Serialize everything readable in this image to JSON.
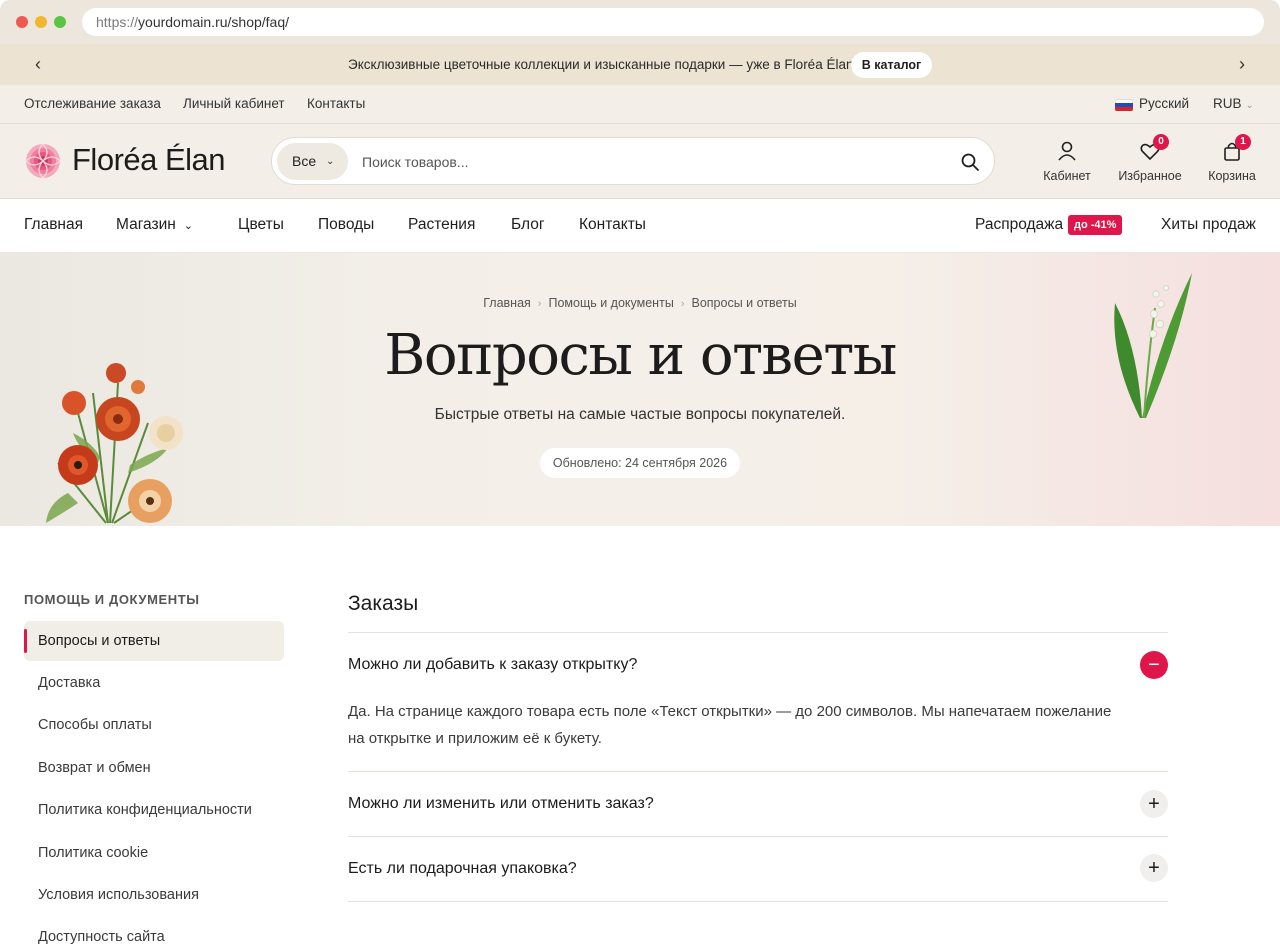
{
  "browser": {
    "url_scheme": "https://",
    "url_rest": "yourdomain.ru/shop/faq/"
  },
  "promo": {
    "text": "Эксклюзивные цветочные коллекции и изысканные подарки — уже в Floréa Élan.",
    "button": "В каталог",
    "prev_icon": "‹",
    "next_icon": "›"
  },
  "utility": {
    "links": [
      "Отслеживание заказа",
      "Личный кабинет",
      "Контакты"
    ],
    "language": "Русский",
    "currency": "RUB"
  },
  "header": {
    "brand": "Floréa Élan",
    "search_category": "Все",
    "search_placeholder": "Поиск товаров...",
    "account_label": "Кабинет",
    "wishlist_label": "Избранное",
    "wishlist_count": "0",
    "cart_label": "Корзина",
    "cart_count": "1"
  },
  "nav": {
    "items": [
      "Главная",
      "Магазин",
      "Цветы",
      "Поводы",
      "Растения",
      "Блог",
      "Контакты"
    ],
    "sale_label": "Распродажа",
    "sale_badge": "до -41%",
    "bestsellers": "Хиты продаж"
  },
  "hero": {
    "breadcrumb": [
      "Главная",
      "Помощь и документы",
      "Вопросы и ответы"
    ],
    "title": "Вопросы и ответы",
    "subtitle": "Быстрые ответы на самые частые вопросы покупателей.",
    "updated": "Обновлено: 24 сентября 2026"
  },
  "sidebar": {
    "title": "ПОМОЩЬ И ДОКУМЕНТЫ",
    "items": [
      "Вопросы и ответы",
      "Доставка",
      "Способы оплаты",
      "Возврат и обмен",
      "Политика конфиденциальности",
      "Политика cookie",
      "Условия использования",
      "Доступность сайта"
    ]
  },
  "faq": {
    "section_title": "Заказы",
    "questions": [
      {
        "question": "Можно ли добавить к заказу открытку?",
        "answer": "Да. На странице каждого товара есть поле «Текст открытки» — до 200 символов. Мы напечатаем пожелание на открытке и приложим её к букету.",
        "expanded": true
      },
      {
        "question": "Можно ли изменить или отменить заказ?",
        "expanded": false
      },
      {
        "question": "Есть ли подарочная упаковка?",
        "expanded": false
      }
    ],
    "collapse_icon": "−",
    "expand_icon": "+"
  },
  "colors": {
    "accent": "#e0154a",
    "cream": "#f3efe8",
    "promo_bg": "#ede3d3"
  }
}
